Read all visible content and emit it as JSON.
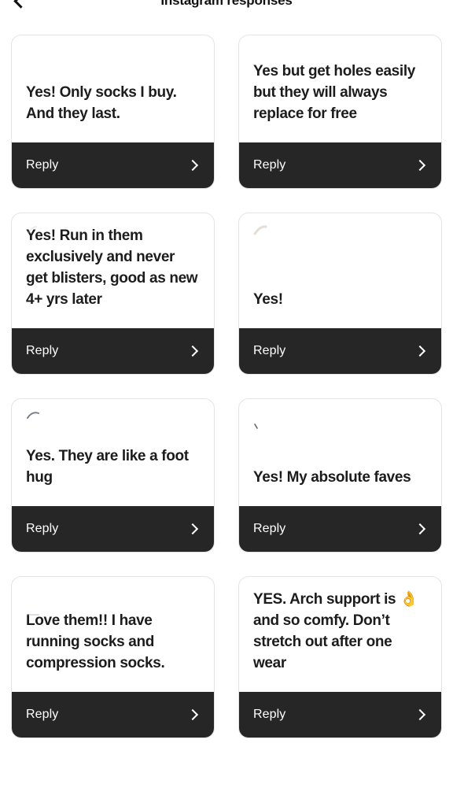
{
  "header": {
    "title": "Instagram responses",
    "back_icon": "chevron-left-icon"
  },
  "theme": {
    "background": "#ffffff",
    "card_background": "#ffffff",
    "card_border": "#e4e4e4",
    "footer_background": "#262626",
    "footer_text": "#ffffff",
    "body_text": "#1c1c1c"
  },
  "reply": {
    "label": "Reply",
    "chevron_icon": "chevron-right-icon"
  },
  "cards": [
    {
      "text": "Yes! Only socks I buy. And they last.",
      "reply_label": "Reply",
      "mark": "none"
    },
    {
      "text": "Yes but get holes easily but they will always replace for free",
      "reply_label": "Reply",
      "mark": "none"
    },
    {
      "text": "Yes! Run in them exclusively and never get blisters, good as new 4+ yrs later",
      "reply_label": "Reply",
      "mark": "faint-gray"
    },
    {
      "text": "Yes!",
      "reply_label": "Reply",
      "mark": "faint-tan"
    },
    {
      "text": "Yes. They are like a foot hug",
      "reply_label": "Reply",
      "mark": "faint-dark"
    },
    {
      "text": "Yes! My absolute faves",
      "reply_label": "Reply",
      "mark": "faint-tick"
    },
    {
      "text": "Love them!! I have running socks and compression socks.",
      "reply_label": "Reply",
      "mark": "faint-dash"
    },
    {
      "text_before_emoji": "YES. Arch support is ",
      "emoji": "👌",
      "text_after_emoji": " and so comfy. Don’t stretch out after one wear",
      "text": "YES. Arch support is 👌 and so comfy. Don’t stretch out after one wear",
      "reply_label": "Reply",
      "mark": "none"
    }
  ]
}
